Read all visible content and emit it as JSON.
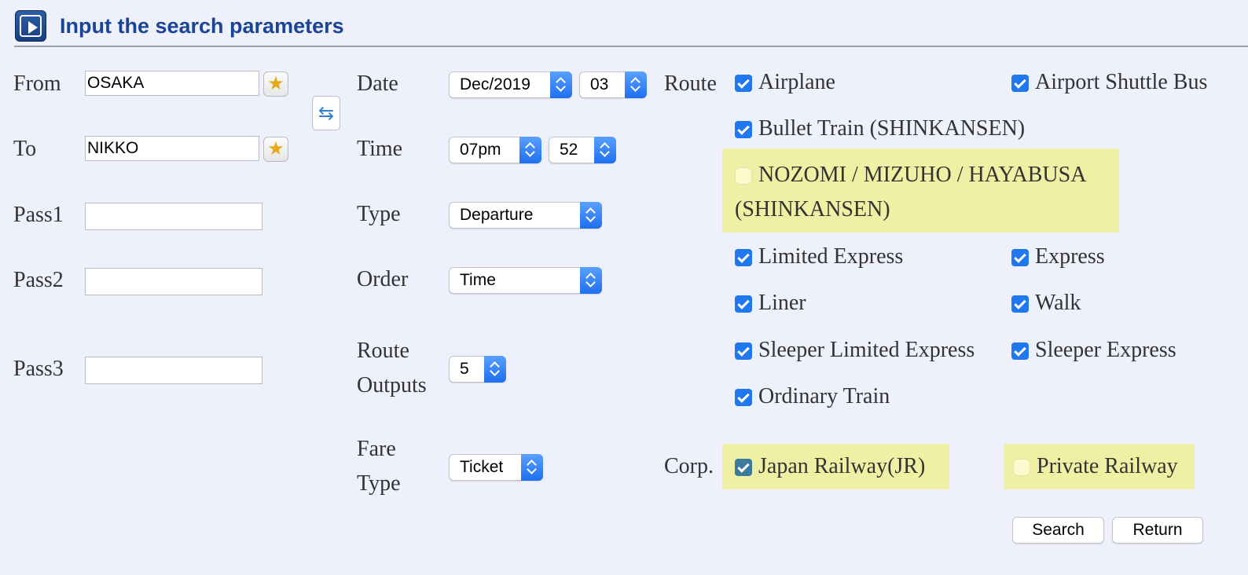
{
  "header": {
    "title": "Input the search parameters",
    "icon": "play-icon"
  },
  "left": {
    "from": {
      "label": "From",
      "value": "OSAKA"
    },
    "to": {
      "label": "To",
      "value": "NIKKO"
    },
    "pass1": {
      "label": "Pass1",
      "value": ""
    },
    "pass2": {
      "label": "Pass2",
      "value": ""
    },
    "pass3": {
      "label": "Pass3",
      "value": ""
    }
  },
  "middle": {
    "date": {
      "label": "Date",
      "month": "Dec/2019",
      "day": "03"
    },
    "time": {
      "label": "Time",
      "hour": "07pm",
      "minute": "52"
    },
    "type": {
      "label": "Type",
      "value": "Departure"
    },
    "order": {
      "label": "Order",
      "value": "Time"
    },
    "route_outputs": {
      "label_line1": "Route",
      "label_line2": "Outputs",
      "value": "5"
    },
    "fare_type": {
      "label_line1": "Fare",
      "label_line2": "Type",
      "value": "Ticket"
    }
  },
  "route": {
    "label": "Route",
    "airplane": {
      "label": "Airplane",
      "checked": true
    },
    "airport_shuttle_bus": {
      "label": "Airport Shuttle Bus",
      "checked": true
    },
    "bullet_train": {
      "label": "Bullet Train (SHINKANSEN)",
      "checked": true
    },
    "nozomi": {
      "label_line1": "NOZOMI / MIZUHO / HAYABUSA",
      "label_line2": "(SHINKANSEN)",
      "checked": false
    },
    "limited_express": {
      "label": "Limited Express",
      "checked": true
    },
    "express": {
      "label": "Express",
      "checked": true
    },
    "liner": {
      "label": "Liner",
      "checked": true
    },
    "walk": {
      "label": "Walk",
      "checked": true
    },
    "sleeper_limited_express": {
      "label": "Sleeper Limited Express",
      "checked": true
    },
    "sleeper_express": {
      "label": "Sleeper Express",
      "checked": true
    },
    "ordinary_train": {
      "label": "Ordinary Train",
      "checked": true
    }
  },
  "corp": {
    "label": "Corp.",
    "jr": {
      "label": "Japan Railway(JR)",
      "checked": true
    },
    "private": {
      "label": "Private Railway",
      "checked": false
    }
  },
  "buttons": {
    "search": "Search",
    "return": "Return"
  },
  "colors": {
    "header_title": "#1a4496",
    "highlight": "#eff0a4",
    "checkbox": "#1f78f0",
    "background": "#eef0fb"
  }
}
